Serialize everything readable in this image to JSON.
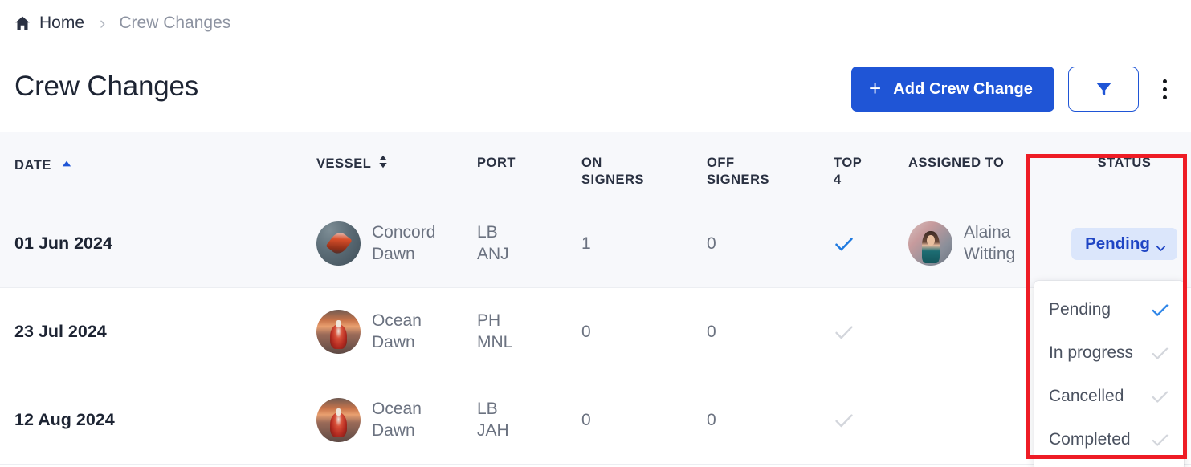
{
  "breadcrumb": {
    "home_label": "Home",
    "home_icon": "home-icon",
    "separator": "›",
    "current_label": "Crew Changes"
  },
  "header": {
    "title": "Crew Changes",
    "add_button_label": "Add Crew Change",
    "add_button_plus": "+",
    "filter_icon": "funnel-icon",
    "more_icon": "kebab-menu-icon",
    "accent_color": "#1f55d6"
  },
  "table": {
    "columns": [
      {
        "key": "date",
        "label": "DATE",
        "sort": "asc",
        "sort_color": "#1f55d6"
      },
      {
        "key": "vessel",
        "label": "VESSEL",
        "sort": "both",
        "sort_color": "#2a3142"
      },
      {
        "key": "port",
        "label": "PORT",
        "sort": "none"
      },
      {
        "key": "on",
        "label": "ON SIGNERS",
        "sort": "none"
      },
      {
        "key": "off",
        "label": "OFF SIGNERS",
        "sort": "none"
      },
      {
        "key": "top4",
        "label": "TOP 4",
        "sort": "none"
      },
      {
        "key": "assign",
        "label": "ASSIGNED TO",
        "sort": "none"
      },
      {
        "key": "status",
        "label": "STATUS",
        "sort": "none"
      }
    ],
    "rows": [
      {
        "date": "01 Jun 2024",
        "vessel": "Concord Dawn",
        "vessel_thumb": "ship-photo-concord-dawn",
        "port": "LB ANJ",
        "on_signers": "1",
        "off_signers": "0",
        "top4": true,
        "assigned_to": "Alaina Witting",
        "assigned_avatar": "avatar-alaina-witting",
        "status": "Pending"
      },
      {
        "date": "23 Jul 2024",
        "vessel": "Ocean Dawn",
        "vessel_thumb": "ship-photo-ocean-dawn",
        "port": "PH MNL",
        "on_signers": "0",
        "off_signers": "0",
        "top4": false,
        "assigned_to": "",
        "assigned_avatar": "",
        "status": ""
      },
      {
        "date": "12 Aug 2024",
        "vessel": "Ocean Dawn",
        "vessel_thumb": "ship-photo-ocean-dawn",
        "port": "LB JAH",
        "on_signers": "0",
        "off_signers": "0",
        "top4": false,
        "assigned_to": "",
        "assigned_avatar": "",
        "status": ""
      }
    ]
  },
  "status_dropdown": {
    "open": true,
    "selected": "Pending",
    "items": [
      {
        "label": "Pending",
        "selected": true
      },
      {
        "label": "In progress",
        "selected": false
      },
      {
        "label": "Cancelled",
        "selected": false
      },
      {
        "label": "Completed",
        "selected": false
      }
    ],
    "selected_check_color": "#2f86e8",
    "unselected_check_color": "#d3d6dc"
  },
  "annotation": {
    "type": "highlight-rectangle",
    "color": "#ee1c25"
  }
}
